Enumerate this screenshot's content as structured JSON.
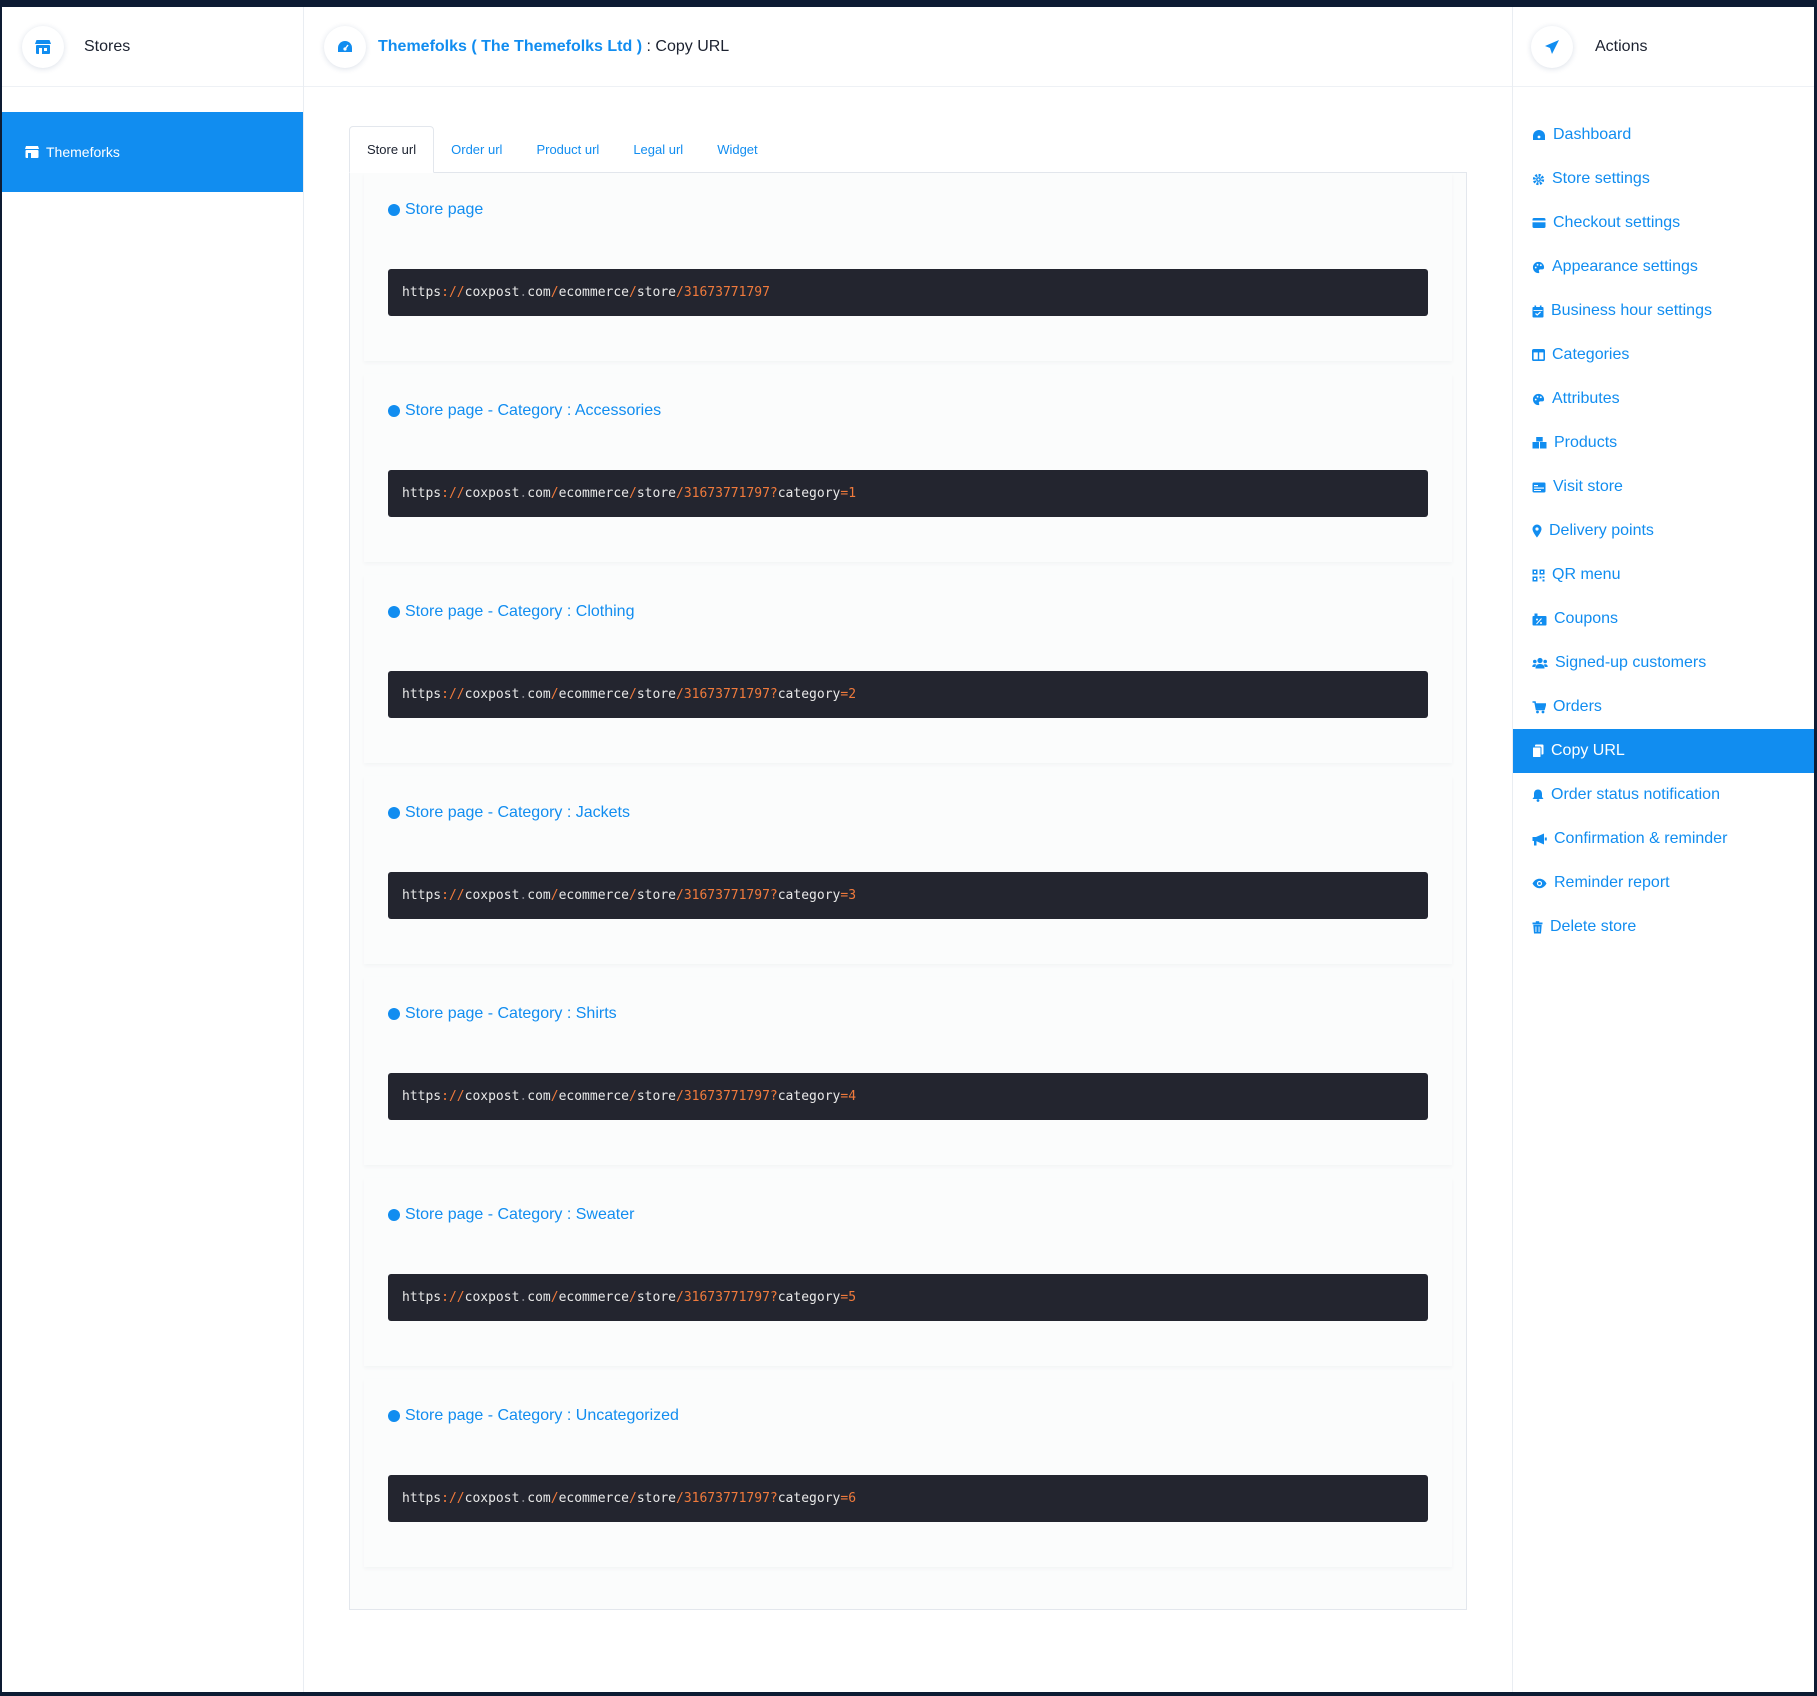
{
  "left_panel": {
    "title": "Stores",
    "store_item": {
      "label": "Themeforks"
    }
  },
  "header": {
    "store_name": "Themefolks",
    "owner": "( The Themefolks Ltd )",
    "section": ": Copy URL"
  },
  "tabs": [
    {
      "label": "Store url",
      "active": true
    },
    {
      "label": "Order url",
      "active": false
    },
    {
      "label": "Product url",
      "active": false
    },
    {
      "label": "Legal url",
      "active": false
    },
    {
      "label": "Widget",
      "active": false
    }
  ],
  "url_blocks": [
    {
      "title": "Store page",
      "url": {
        "scheme": "https",
        "p1": "://",
        "host1": "coxpost",
        "p2": ".",
        "host2": "com",
        "p3": "/",
        "path1": "ecommerce",
        "p4": "/",
        "path2": "store",
        "p5": "/",
        "id": "31673771797",
        "q": "",
        "param": "",
        "eq": "",
        "val": ""
      }
    },
    {
      "title": "Store page - Category : Accessories",
      "url": {
        "scheme": "https",
        "p1": "://",
        "host1": "coxpost",
        "p2": ".",
        "host2": "com",
        "p3": "/",
        "path1": "ecommerce",
        "p4": "/",
        "path2": "store",
        "p5": "/",
        "id": "31673771797",
        "q": "?",
        "param": "category",
        "eq": "=",
        "val": "1"
      }
    },
    {
      "title": "Store page - Category : Clothing",
      "url": {
        "scheme": "https",
        "p1": "://",
        "host1": "coxpost",
        "p2": ".",
        "host2": "com",
        "p3": "/",
        "path1": "ecommerce",
        "p4": "/",
        "path2": "store",
        "p5": "/",
        "id": "31673771797",
        "q": "?",
        "param": "category",
        "eq": "=",
        "val": "2"
      }
    },
    {
      "title": "Store page - Category : Jackets",
      "url": {
        "scheme": "https",
        "p1": "://",
        "host1": "coxpost",
        "p2": ".",
        "host2": "com",
        "p3": "/",
        "path1": "ecommerce",
        "p4": "/",
        "path2": "store",
        "p5": "/",
        "id": "31673771797",
        "q": "?",
        "param": "category",
        "eq": "=",
        "val": "3"
      }
    },
    {
      "title": "Store page - Category : Shirts",
      "url": {
        "scheme": "https",
        "p1": "://",
        "host1": "coxpost",
        "p2": ".",
        "host2": "com",
        "p3": "/",
        "path1": "ecommerce",
        "p4": "/",
        "path2": "store",
        "p5": "/",
        "id": "31673771797",
        "q": "?",
        "param": "category",
        "eq": "=",
        "val": "4"
      }
    },
    {
      "title": "Store page - Category : Sweater",
      "url": {
        "scheme": "https",
        "p1": "://",
        "host1": "coxpost",
        "p2": ".",
        "host2": "com",
        "p3": "/",
        "path1": "ecommerce",
        "p4": "/",
        "path2": "store",
        "p5": "/",
        "id": "31673771797",
        "q": "?",
        "param": "category",
        "eq": "=",
        "val": "5"
      }
    },
    {
      "title": "Store page - Category : Uncategorized",
      "url": {
        "scheme": "https",
        "p1": "://",
        "host1": "coxpost",
        "p2": ".",
        "host2": "com",
        "p3": "/",
        "path1": "ecommerce",
        "p4": "/",
        "path2": "store",
        "p5": "/",
        "id": "31673771797",
        "q": "?",
        "param": "category",
        "eq": "=",
        "val": "6"
      }
    }
  ],
  "actions": {
    "title": "Actions",
    "items": [
      {
        "label": "Dashboard",
        "icon": "dashboard-icon"
      },
      {
        "label": "Store settings",
        "icon": "gear-icon"
      },
      {
        "label": "Checkout settings",
        "icon": "credit-card-icon"
      },
      {
        "label": "Appearance settings",
        "icon": "palette-icon"
      },
      {
        "label": "Business hour settings",
        "icon": "calendar-icon"
      },
      {
        "label": "Categories",
        "icon": "columns-icon"
      },
      {
        "label": "Attributes",
        "icon": "palette-icon"
      },
      {
        "label": "Products",
        "icon": "boxes-icon"
      },
      {
        "label": "Visit store",
        "icon": "id-card-icon"
      },
      {
        "label": "Delivery points",
        "icon": "map-marker-icon"
      },
      {
        "label": "QR menu",
        "icon": "qrcode-icon"
      },
      {
        "label": "Coupons",
        "icon": "coupon-icon"
      },
      {
        "label": "Signed-up customers",
        "icon": "users-icon"
      },
      {
        "label": "Orders",
        "icon": "cart-icon"
      },
      {
        "label": "Copy URL",
        "icon": "copy-icon",
        "active": true
      },
      {
        "label": "Order status notification",
        "icon": "bell-icon"
      },
      {
        "label": "Confirmation & reminder",
        "icon": "megaphone-icon"
      },
      {
        "label": "Reminder report",
        "icon": "eye-icon"
      },
      {
        "label": "Delete store",
        "icon": "trash-icon"
      }
    ]
  },
  "colors": {
    "primary": "#118df0",
    "code_bg": "#23252f",
    "code_number": "#f07a3c"
  }
}
